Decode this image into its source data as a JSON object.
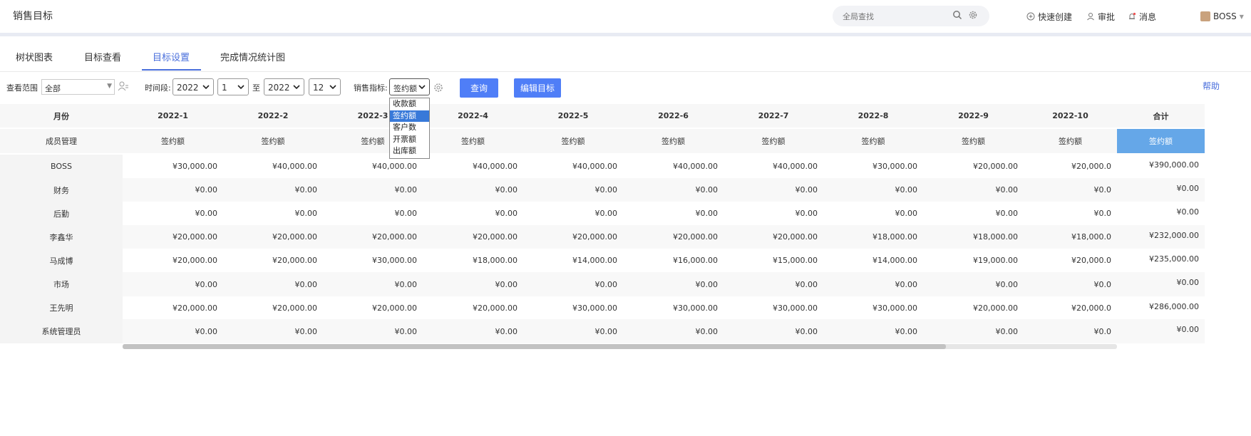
{
  "app": {
    "title": "销售目标"
  },
  "search": {
    "placeholder": "全局查找"
  },
  "top_actions": {
    "quick_create": "快速创建",
    "approve": "审批",
    "messages": "消息",
    "user": "BOSS"
  },
  "tabs": [
    {
      "label": "树状图表"
    },
    {
      "label": "目标查看"
    },
    {
      "label": "目标设置",
      "active": true
    },
    {
      "label": "完成情况统计图"
    }
  ],
  "toolbar": {
    "scope_label": "查看范围",
    "scope_value": "全部",
    "period_label": "时间段:",
    "start_year": "2022",
    "start_month": "1",
    "to_label": "至",
    "end_year": "2022",
    "end_month": "12",
    "metric_label": "销售指标:",
    "metric_value": "签约额",
    "query_button": "查询",
    "edit_button": "编辑目标",
    "help": "帮助"
  },
  "metric_options": [
    "收款额",
    "签约额",
    "客户数",
    "开票额",
    "出库额"
  ],
  "metric_selected_index": 1,
  "table": {
    "header_month": "月份",
    "header_member": "成员管理",
    "months": [
      "2022-1",
      "2022-2",
      "2022-3",
      "2022-4",
      "2022-5",
      "2022-6",
      "2022-7",
      "2022-8",
      "2022-9",
      "2022-10"
    ],
    "total_label": "合计",
    "metric_sub": "签约额",
    "rows": [
      {
        "name": "BOSS",
        "values": [
          "¥30,000.00",
          "¥40,000.00",
          "¥40,000.00",
          "¥40,000.00",
          "¥40,000.00",
          "¥40,000.00",
          "¥40,000.00",
          "¥30,000.00",
          "¥20,000.00",
          "¥20,000.0"
        ],
        "total": "¥390,000.00"
      },
      {
        "name": "财务",
        "values": [
          "¥0.00",
          "¥0.00",
          "¥0.00",
          "¥0.00",
          "¥0.00",
          "¥0.00",
          "¥0.00",
          "¥0.00",
          "¥0.00",
          "¥0.0"
        ],
        "total": "¥0.00"
      },
      {
        "name": "后勤",
        "values": [
          "¥0.00",
          "¥0.00",
          "¥0.00",
          "¥0.00",
          "¥0.00",
          "¥0.00",
          "¥0.00",
          "¥0.00",
          "¥0.00",
          "¥0.0"
        ],
        "total": "¥0.00"
      },
      {
        "name": "李鑫华",
        "values": [
          "¥20,000.00",
          "¥20,000.00",
          "¥20,000.00",
          "¥20,000.00",
          "¥20,000.00",
          "¥20,000.00",
          "¥20,000.00",
          "¥18,000.00",
          "¥18,000.00",
          "¥18,000.0"
        ],
        "total": "¥232,000.00"
      },
      {
        "name": "马成博",
        "values": [
          "¥20,000.00",
          "¥20,000.00",
          "¥30,000.00",
          "¥18,000.00",
          "¥14,000.00",
          "¥16,000.00",
          "¥15,000.00",
          "¥14,000.00",
          "¥19,000.00",
          "¥20,000.0"
        ],
        "total": "¥235,000.00"
      },
      {
        "name": "市场",
        "values": [
          "¥0.00",
          "¥0.00",
          "¥0.00",
          "¥0.00",
          "¥0.00",
          "¥0.00",
          "¥0.00",
          "¥0.00",
          "¥0.00",
          "¥0.0"
        ],
        "total": "¥0.00"
      },
      {
        "name": "王先明",
        "values": [
          "¥20,000.00",
          "¥20,000.00",
          "¥20,000.00",
          "¥20,000.00",
          "¥30,000.00",
          "¥30,000.00",
          "¥30,000.00",
          "¥30,000.00",
          "¥20,000.00",
          "¥20,000.0"
        ],
        "total": "¥286,000.00"
      },
      {
        "name": "系统管理员",
        "values": [
          "¥0.00",
          "¥0.00",
          "¥0.00",
          "¥0.00",
          "¥0.00",
          "¥0.00",
          "¥0.00",
          "¥0.00",
          "¥0.00",
          "¥0.0"
        ],
        "total": "¥0.00"
      }
    ]
  },
  "colors": {
    "accent": "#4a6fdc",
    "button": "#4f7ef7",
    "total_header": "#65a7e8",
    "dropdown_selected": "#3879d9"
  }
}
